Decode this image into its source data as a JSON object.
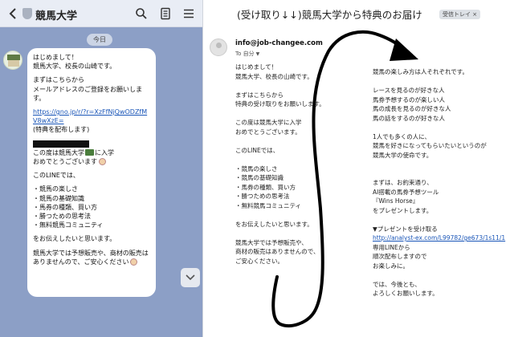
{
  "line_chat": {
    "title": "競馬大学",
    "date_chip": "今日",
    "icons": [
      "back-icon",
      "shield-icon",
      "search-icon",
      "note-icon",
      "menu-icon",
      "chevron-down-icon"
    ],
    "message": {
      "p1": "はじめまして！\n競馬大学、校長の山崎です。",
      "p2": "まずはこちらから\nメールアドレスのご登録をお願いします。",
      "link": "https://gno.jp/r/?r=XzFfNjQwODZfMV8wXzE=",
      "p3": "(特典を配布します)",
      "p4a": "この度は競馬大学",
      "p4b": "に入学",
      "p4c": "おめでとうございます",
      "p5": "このLINEでは、",
      "p6": "・競馬の楽しさ\n・競馬の基礎知識\n・馬券の種類、買い方\n・勝つための思考法\n・無料競馬コミュニティ",
      "p7": "をお伝えしたいと思います。",
      "p8": "競馬大学では予想販売や、商材の販売はありませんので、ご安心ください"
    }
  },
  "email": {
    "subject": "(受け取り↓↓)競馬大学から特典のお届け",
    "inbox_chip": "受信トレイ ×",
    "sender": "info@job-changee.com",
    "to": "To 自分",
    "col1": "はじめまして！\n競馬大学、校長の山崎です。\n\nまずはこちらから\n特典の受け取りをお願いします。\n\nこの度は競馬大学に入学\nおめでとうございます。\n\nこのLINEでは、\n\n・競馬の楽しさ\n・競馬の基礎知識\n・馬券の種類、買い方\n・勝つための思考法\n・無料競馬コミュニティ\n\nをお伝えしたいと思います。\n\n競馬大学では予想販売や、\n商材の販売はありませんので、\nご安心ください。",
    "col2_top": "競馬の楽しみ方は人それぞれです。\n\nレースを見るのが好きな人\n馬券予想するのが楽しい人\n馬の成長を見るのが好きな人\n馬の話をするのが好きな人\n\n1人でも多くの人に、\n競馬を好きになってもらいたいというのが\n競馬大学の使命です。\n\n\nまずは、お約束通り、\nAI搭載の馬券予想ツール\n『Wins Horse』\nをプレゼントします。\n\n▼プレゼントを受け取る",
    "link": "http://analyst-ex.com/L99782/ge673/1s11/1",
    "col2_bottom": "\n専用LINEから\n順次配布しますので\nお楽しみに。\n\nでは、今後とも、\nよろしくお願いします。"
  },
  "colors": {
    "line_background": "#8c9fc6",
    "line_header": "#e9edf5",
    "bubble": "#ffffff",
    "link": "#1a56b8",
    "annotation_stroke": "#000000"
  }
}
